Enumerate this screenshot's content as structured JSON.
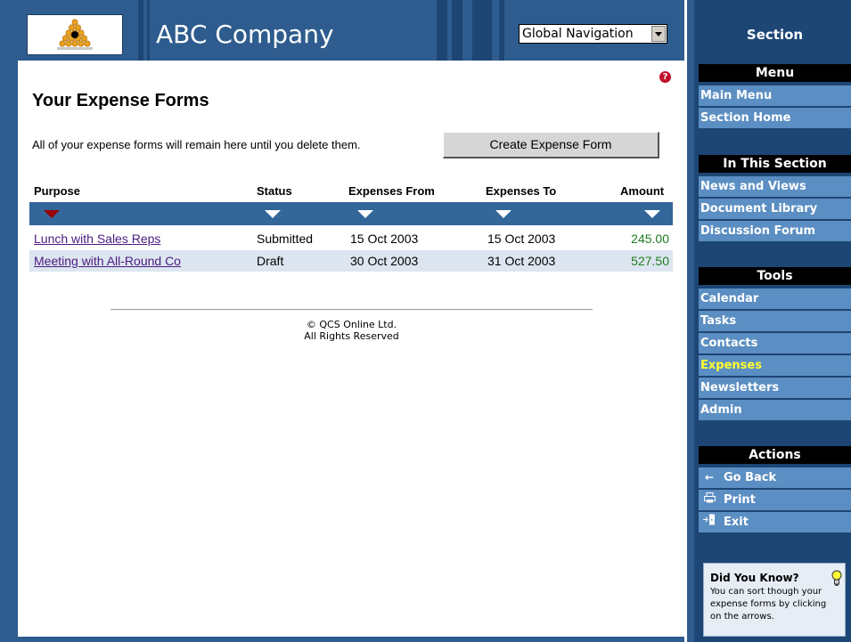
{
  "header": {
    "company_name": "ABC Company",
    "global_nav_value": "Global Navigation"
  },
  "main": {
    "title": "Your Expense Forms",
    "intro": "All of your expense forms will remain here until you delete them.",
    "create_button": "Create Expense Form",
    "columns": [
      "Purpose",
      "Status",
      "Expenses From",
      "Expenses To",
      "Amount"
    ],
    "rows": [
      {
        "purpose": "Lunch with Sales Reps",
        "status": "Submitted",
        "from": "15 Oct 2003",
        "to": "15 Oct 2003",
        "amount": "245.00"
      },
      {
        "purpose": "Meeting with All-Round Co",
        "status": "Draft",
        "from": "30 Oct 2003",
        "to": "31 Oct 2003",
        "amount": "527.50"
      }
    ],
    "active_sort_column": "Purpose"
  },
  "footer": {
    "line1": "© QCS Online Ltd.",
    "line2": "All Rights Reserved"
  },
  "sidebar": {
    "title": "Section",
    "menu_heading": "Menu",
    "menu_items": [
      "Main Menu",
      "Section Home"
    ],
    "in_section_heading": "In This Section",
    "in_section_items": [
      "News and Views",
      "Document Library",
      "Discussion Forum"
    ],
    "tools_heading": "Tools",
    "tools_items": [
      "Calendar",
      "Tasks",
      "Contacts",
      "Expenses",
      "Newsletters",
      "Admin"
    ],
    "current_tool": "Expenses",
    "actions_heading": "Actions",
    "actions": [
      {
        "label": "Go Back",
        "icon": "arrow-left-icon"
      },
      {
        "label": "Print",
        "icon": "printer-icon"
      },
      {
        "label": "Exit",
        "icon": "exit-door-icon"
      }
    ]
  },
  "tip": {
    "title": "Did You Know?",
    "text": "You can sort though your expense forms by clicking on the arrows."
  },
  "colors": {
    "header_blue": "#2e5c8e",
    "dark_blue": "#1d4675",
    "nav_item_blue": "#5b8ec2",
    "current_item": "#ffff33",
    "amount_green": "#1f7a1f",
    "link_purple": "#4b1a80"
  }
}
